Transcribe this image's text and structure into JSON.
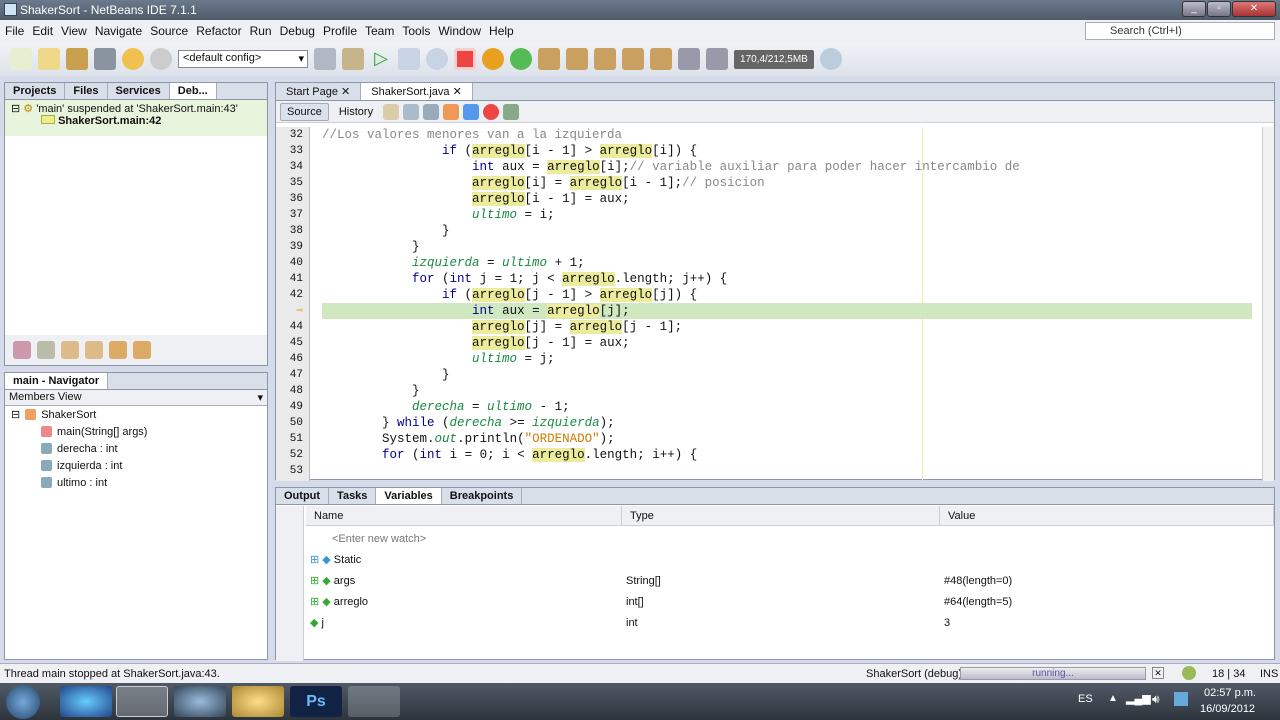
{
  "window": {
    "title": "ShakerSort - NetBeans IDE 7.1.1"
  },
  "menu": [
    "File",
    "Edit",
    "View",
    "Navigate",
    "Source",
    "Refactor",
    "Run",
    "Debug",
    "Profile",
    "Team",
    "Tools",
    "Window",
    "Help"
  ],
  "search": {
    "placeholder": "Search (Ctrl+I)"
  },
  "toolbar": {
    "config": "<default config>",
    "memory": "170,4/212,5MB"
  },
  "left_panel": {
    "tabs": [
      "Projects",
      "Files",
      "Services",
      "Deb..."
    ],
    "thread": "'main' suspended at 'ShakerSort.main:43'",
    "frame": "ShakerSort.main:42"
  },
  "navigator": {
    "title": "main - Navigator",
    "view": "Members View",
    "class": "ShakerSort",
    "members": [
      "main(String[] args)",
      "derecha : int",
      "izquierda : int",
      "ultimo : int"
    ]
  },
  "editor": {
    "tabs": [
      "Start Page",
      "ShakerSort.java"
    ],
    "source_label": "Source",
    "history_label": "History",
    "current_line_marker": "⇨",
    "lines": [
      {
        "n": "32",
        "t": "//Los valores menores van a la izquierda"
      },
      {
        "n": "33",
        "t": "                if (arreglo[i - 1] > arreglo[i]) {"
      },
      {
        "n": "34",
        "t": "                    int aux = arreglo[i];// variable auxiliar para poder hacer intercambio de"
      },
      {
        "n": "35",
        "t": "                    arreglo[i] = arreglo[i - 1];// posicion"
      },
      {
        "n": "36",
        "t": "                    arreglo[i - 1] = aux;"
      },
      {
        "n": "37",
        "t": "                    ultimo = i;"
      },
      {
        "n": "38",
        "t": "                }"
      },
      {
        "n": "39",
        "t": "            }"
      },
      {
        "n": "40",
        "t": "            izquierda = ultimo + 1;"
      },
      {
        "n": "41",
        "t": "            for (int j = 1; j < arreglo.length; j++) {"
      },
      {
        "n": "42",
        "t": "                if (arreglo[j - 1] > arreglo[j]) {"
      },
      {
        "n": "43",
        "t": "                    int aux = arreglo[j];",
        "current": true
      },
      {
        "n": "44",
        "t": "                    arreglo[j] = arreglo[j - 1];"
      },
      {
        "n": "45",
        "t": "                    arreglo[j - 1] = aux;"
      },
      {
        "n": "46",
        "t": "                    ultimo = j;"
      },
      {
        "n": "47",
        "t": "                }"
      },
      {
        "n": "48",
        "t": "            }"
      },
      {
        "n": "49",
        "t": "            derecha = ultimo - 1;"
      },
      {
        "n": "50",
        "t": "        } while (derecha >= izquierda);"
      },
      {
        "n": "51",
        "t": "        System.out.println(\"ORDENADO\");"
      },
      {
        "n": "52",
        "t": "        for (int i = 0; i < arreglo.length; i++) {"
      },
      {
        "n": "53",
        "t": ""
      }
    ]
  },
  "bottom": {
    "tabs": [
      "Output",
      "Tasks",
      "Variables",
      "Breakpoints"
    ],
    "columns": [
      "Name",
      "Type",
      "Value"
    ],
    "rows": [
      {
        "name": "<Enter new watch>",
        "type": "",
        "value": ""
      },
      {
        "name": "Static",
        "type": "",
        "value": ""
      },
      {
        "name": "args",
        "type": "String[]",
        "value": "#48(length=0)"
      },
      {
        "name": "arreglo",
        "type": "int[]",
        "value": "#64(length=5)"
      },
      {
        "name": "j",
        "type": "int",
        "value": "3"
      }
    ]
  },
  "status": {
    "message": "Thread main stopped at ShakerSort.java:43.",
    "task": "ShakerSort (debug)",
    "progress_text": "running...",
    "position": "18 | 34",
    "mode": "INS"
  },
  "taskbar": {
    "lang": "ES",
    "time": "02:57 p.m.",
    "date": "16/09/2012"
  }
}
